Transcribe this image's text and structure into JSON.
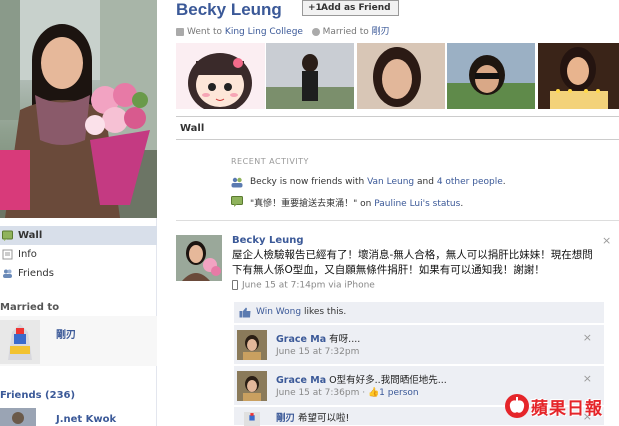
{
  "profile": {
    "name": "Becky Leung",
    "add_friend_label": "Add as Friend",
    "went_to_prefix": "Went to",
    "school": "King Ling College",
    "married_prefix": "Married to",
    "spouse": "剛刃"
  },
  "tabs": {
    "wall": "Wall"
  },
  "left_nav": [
    {
      "label": "Wall",
      "icon": "wall-icon",
      "active": true
    },
    {
      "label": "Info",
      "icon": "info-icon",
      "active": false
    },
    {
      "label": "Friends",
      "icon": "friends-icon",
      "active": false
    }
  ],
  "left_sections": {
    "married_to_title": "Married to",
    "spouse_name": "剛刃",
    "friends_title": "Friends (236)",
    "friend_name": "J.net Kwok"
  },
  "recent_activity": {
    "title": "RECENT ACTIVITY",
    "item1": {
      "prefix": "Becky is now friends with",
      "friend": "Van Leung",
      "and": "and",
      "others": "4 other people",
      "suffix": "."
    },
    "item2": {
      "quote": "\"真慘！重要搶送去東涌！\" on",
      "target": "Pauline Lui's status",
      "suffix": "."
    }
  },
  "post": {
    "author": "Becky Leung",
    "text": "屋企人檢驗報告已經有了！壞消息-無人合格，無人可以捐肝比妹妹！現在想問下有無人係O型血，又自願無條件捐肝！如果有可以通知我！謝謝！",
    "meta": "June 15 at 7:14pm via iPhone",
    "close": "×"
  },
  "likes": {
    "name": "Win Wong",
    "suffix": "likes this."
  },
  "comments": [
    {
      "author": "Grace Ma",
      "text": "有呀....",
      "time": "June 15 at 7:32pm",
      "extra": ""
    },
    {
      "author": "Grace Ma",
      "text": "O型有好多..我問晒佢地先...",
      "time": "June 15 at 7:36pm · ",
      "extra": "1 person"
    },
    {
      "author": "剛刃",
      "text": "希望可以啦!",
      "time": "",
      "extra": ""
    }
  ],
  "watermark": "蘋果日報",
  "colors": {
    "brand": "#3b5998",
    "nav_active": "#d8dfea",
    "comment_bg": "#edeff4",
    "watermark": "#e5252a"
  }
}
